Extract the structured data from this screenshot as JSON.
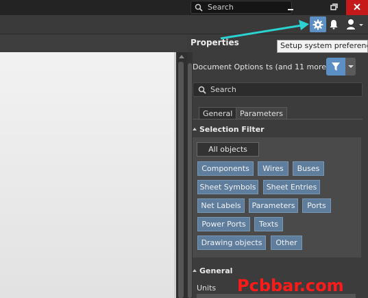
{
  "titlebar": {
    "search_placeholder": "Search",
    "minimize_label": "–",
    "restore_label": "⧉",
    "close_label": "✕"
  },
  "toolbar": {
    "gear_icon": "gear-icon",
    "bell_icon": "bell-icon",
    "user_icon": "user-icon"
  },
  "tooltip": "Setup system preferences",
  "panel": {
    "title": "Properties",
    "document_options": "Document Options",
    "count_text": "ts (and 11 more)",
    "search_placeholder": "Search",
    "tabs": [
      "General",
      "Parameters"
    ],
    "selection_filter": {
      "title": "Selection Filter",
      "all_objects": "All objects",
      "chips": [
        "Components",
        "Wires",
        "Buses",
        "Sheet Symbols",
        "Sheet Entries",
        "Net Labels",
        "Parameters",
        "Ports",
        "Power Ports",
        "Texts",
        "Drawing objects",
        "Other"
      ]
    },
    "general": {
      "title": "General",
      "units_label": "Units"
    }
  },
  "watermark": "Pcbbar.com",
  "colors": {
    "accent": "#5c8fc4",
    "chip": "#5f7e9e",
    "close": "#c41a1a",
    "arrow": "#2bd3d3",
    "watermark": "#ff1a1a"
  }
}
